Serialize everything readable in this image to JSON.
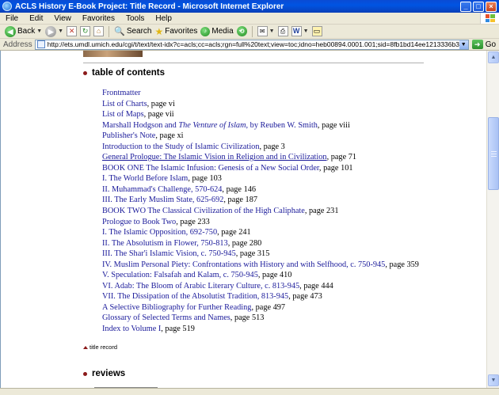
{
  "window": {
    "title": "ACLS History E-Book Project: Title Record - Microsoft Internet Explorer",
    "minimize_glyph": "_",
    "maximize_glyph": "□",
    "close_glyph": "×"
  },
  "menu": {
    "items": [
      "File",
      "Edit",
      "View",
      "Favorites",
      "Tools",
      "Help"
    ]
  },
  "toolbar": {
    "back_label": "Back",
    "search_label": "Search",
    "favorites_label": "Favorites",
    "media_label": "Media"
  },
  "address": {
    "label": "Address",
    "url": "http://ets.umdl.umich.edu/cgi/t/text/text-idx?c=acls;cc=acls;rgn=full%20text;view=toc;idno=heb00894.0001.001;sid=8fb1bd14ee1213336b353fd2e7e3bf27",
    "go_label": "Go"
  },
  "page": {
    "toc_heading": "table of contents",
    "toc": [
      {
        "link": "Frontmatter",
        "rest": ""
      },
      {
        "link": "List of Charts",
        "rest": ", page vi"
      },
      {
        "link": "List of Maps",
        "rest": ", page vii"
      },
      {
        "link": "Marshall Hodgson and ",
        "link_italic": "The Venture of Islam",
        "link_tail": ", by Reuben W. Smith",
        "rest": ", page viii"
      },
      {
        "link": "Publisher's Note",
        "rest": ", page xi"
      },
      {
        "link": "Introduction to the Study of Islamic Civilization",
        "rest": ", page 3"
      },
      {
        "link": "General Prologue: The Islamic Vision in Religion and in Civilization",
        "rest": ", page 71",
        "underline": true
      },
      {
        "link": "BOOK ONE The Islamic Infusion: Genesis of a New Social Order",
        "rest": ", page 101"
      },
      {
        "link": "I. The World Before Islam",
        "rest": ", page 103"
      },
      {
        "link": "II. Muhammad's Challenge, 570-624",
        "rest": ", page 146"
      },
      {
        "link": "III. The Early Muslim State, 625-692",
        "rest": ", page 187"
      },
      {
        "link": "BOOK TWO The Classical Civilization of the High Caliphate",
        "rest": ", page 231"
      },
      {
        "link": "Prologue to Book Two",
        "rest": ", page 233"
      },
      {
        "link": "I. The Islamic Opposition, 692-750",
        "rest": ", page 241"
      },
      {
        "link": "II. The Absolutism in Flower, 750-813",
        "rest": ", page 280"
      },
      {
        "link": "III. The Shar'i Islamic Vision, c. 750-945",
        "rest": ", page 315"
      },
      {
        "link": "IV. Muslim Personal Piety: Confrontations with History and with Selfhood, c. 750-945",
        "rest": ", page 359"
      },
      {
        "link": "V. Speculation: Falsafah and Kalam, c. 750-945",
        "rest": ", page 410"
      },
      {
        "link": "VI. Adab: The Bloom of Arabic Literary Culture, c. 813-945",
        "rest": ", page 444"
      },
      {
        "link": "VII. The Dissipation of the Absolutist Tradition, 813-945",
        "rest": ", page 473"
      },
      {
        "link": "A Selective Bibliography for Further Reading",
        "rest": ", page 497"
      },
      {
        "link": "Glossary of Selected Terms and Names",
        "rest": ", page 513"
      },
      {
        "link": "Index to Volume I",
        "rest": ", page 519"
      }
    ],
    "backlink_label": "title record",
    "reviews_heading": "reviews"
  },
  "colors": {
    "link": "#1a1a9a",
    "bullet": "#8b1a1a",
    "titlebar": "#0054e3"
  }
}
